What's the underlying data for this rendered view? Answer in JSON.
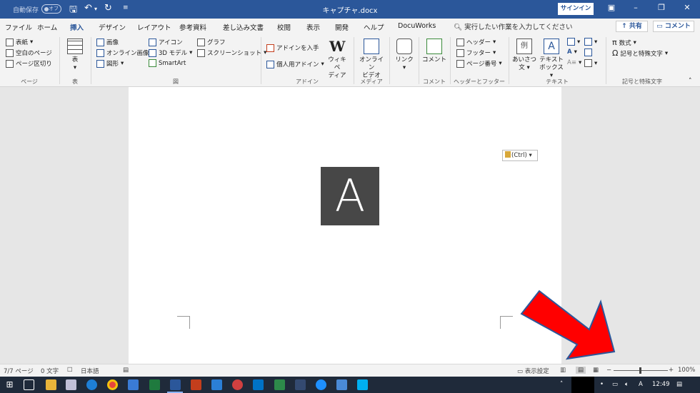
{
  "titlebar": {
    "autosave_label": "自動保存",
    "autosave_state": "オフ",
    "document_title": "キャプチャ.docx",
    "signin_label": "サインイン"
  },
  "tabs": [
    "ファイル",
    "ホーム",
    "挿入",
    "デザイン",
    "レイアウト",
    "参考資料",
    "差し込み文書",
    "校閲",
    "表示",
    "開発",
    "ヘルプ",
    "DocuWorks"
  ],
  "active_tab": "挿入",
  "search_placeholder": "実行したい作業を入力してください",
  "share_label": "共有",
  "comment_label": "コメント",
  "ribbon": {
    "pages": {
      "label": "ページ",
      "items": [
        "表紙",
        "空白のページ",
        "ページ区切り"
      ]
    },
    "table": {
      "label": "表",
      "item": "表"
    },
    "illustrations": {
      "label": "図",
      "items": [
        "画像",
        "オンライン画像",
        "図形",
        "アイコン",
        "3D モデル",
        "SmartArt",
        "グラフ",
        "スクリーンショット"
      ]
    },
    "addins": {
      "label": "アドイン",
      "items": [
        "アドインを入手",
        "個人用アドイン"
      ],
      "wiki_line1": "ウィキペ",
      "wiki_line2": "ディア"
    },
    "media": {
      "label": "メディア",
      "line1": "オンライン",
      "line2": "ビデオ"
    },
    "links": {
      "label": "",
      "item": "リンク"
    },
    "comments": {
      "label": "コメント",
      "item": "コメント"
    },
    "header_footer": {
      "label": "ヘッダーとフッター",
      "items": [
        "ヘッダー",
        "フッター",
        "ページ番号"
      ]
    },
    "text": {
      "label": "テキスト",
      "greeting_line1": "あいさつ",
      "greeting_line2": "文",
      "textbox_line1": "テキスト",
      "textbox_line2": "ボックス",
      "greeting_icon_char": "例"
    },
    "symbols": {
      "label": "記号と特殊文字",
      "items": [
        "数式",
        "記号と特殊文字"
      ]
    }
  },
  "document": {
    "paste_options": "(Ctrl)",
    "image_letter": "A"
  },
  "statusbar": {
    "page": "7/7 ページ",
    "words": "0 文字",
    "language": "日本語",
    "display_settings": "表示設定",
    "zoom": "100%"
  },
  "taskbar": {
    "time": "12:49",
    "ime": "A"
  },
  "colors": {
    "word_blue": "#2b579a",
    "ribbon_bg": "#f3f3f3",
    "image_bg": "#474747",
    "arrow_red": "#ff0000",
    "taskbar_bg": "#1f2a3a"
  }
}
